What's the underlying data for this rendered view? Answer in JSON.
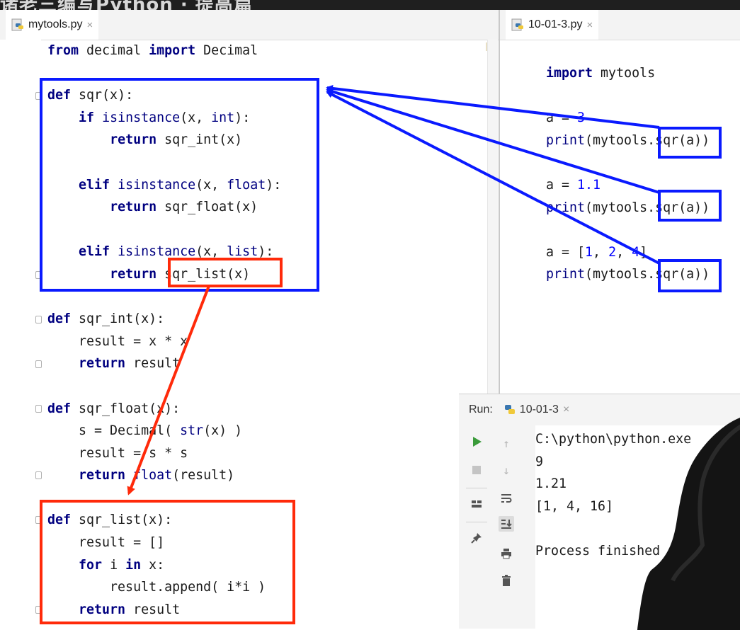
{
  "banner": {
    "text": "诸老三编写Python · 提高篇"
  },
  "editor_left": {
    "tab_label": "mytools.py",
    "lines": [
      [
        [
          "kw",
          "from"
        ],
        [
          "p",
          " decimal "
        ],
        [
          "kw",
          "import"
        ],
        [
          "p",
          " Decimal"
        ]
      ],
      [],
      [
        [
          "kw",
          "def"
        ],
        [
          "p",
          " sqr(x):"
        ]
      ],
      [
        [
          "p",
          "    "
        ],
        [
          "kw",
          "if"
        ],
        [
          "p",
          " "
        ],
        [
          "bi",
          "isinstance"
        ],
        [
          "p",
          "(x, "
        ],
        [
          "bi",
          "int"
        ],
        [
          "p",
          "):"
        ]
      ],
      [
        [
          "p",
          "        "
        ],
        [
          "kw",
          "return"
        ],
        [
          "p",
          " sqr_int(x)"
        ]
      ],
      [],
      [
        [
          "p",
          "    "
        ],
        [
          "kw",
          "elif"
        ],
        [
          "p",
          " "
        ],
        [
          "bi",
          "isinstance"
        ],
        [
          "p",
          "(x, "
        ],
        [
          "bi",
          "float"
        ],
        [
          "p",
          "):"
        ]
      ],
      [
        [
          "p",
          "        "
        ],
        [
          "kw",
          "return"
        ],
        [
          "p",
          " sqr_float(x)"
        ]
      ],
      [],
      [
        [
          "p",
          "    "
        ],
        [
          "kw",
          "elif"
        ],
        [
          "p",
          " "
        ],
        [
          "bi",
          "isinstance"
        ],
        [
          "p",
          "(x, "
        ],
        [
          "bi",
          "list"
        ],
        [
          "p",
          "):"
        ]
      ],
      [
        [
          "p",
          "        "
        ],
        [
          "kw",
          "return"
        ],
        [
          "p",
          " sqr_list(x)"
        ]
      ],
      [],
      [
        [
          "kw",
          "def"
        ],
        [
          "p",
          " sqr_int(x):"
        ]
      ],
      [
        [
          "p",
          "    result = x * x"
        ]
      ],
      [
        [
          "p",
          "    "
        ],
        [
          "kw",
          "return"
        ],
        [
          "p",
          " result"
        ]
      ],
      [],
      [
        [
          "kw",
          "def"
        ],
        [
          "p",
          " sqr_float(x):"
        ]
      ],
      [
        [
          "p",
          "    s = Decimal( "
        ],
        [
          "bi",
          "str"
        ],
        [
          "p",
          "(x) )"
        ]
      ],
      [
        [
          "p",
          "    result = s * s"
        ]
      ],
      [
        [
          "p",
          "    "
        ],
        [
          "kw",
          "return"
        ],
        [
          "p",
          " "
        ],
        [
          "bi",
          "float"
        ],
        [
          "p",
          "(result)"
        ]
      ],
      [],
      [
        [
          "kw",
          "def"
        ],
        [
          "p",
          " sqr_list(x):"
        ]
      ],
      [
        [
          "p",
          "    result = []"
        ]
      ],
      [
        [
          "p",
          "    "
        ],
        [
          "kw",
          "for"
        ],
        [
          "p",
          " i "
        ],
        [
          "kw",
          "in"
        ],
        [
          "p",
          " x:"
        ]
      ],
      [
        [
          "p",
          "        result.append( i*i )"
        ]
      ],
      [
        [
          "p",
          "    "
        ],
        [
          "kw",
          "return"
        ],
        [
          "p",
          " result"
        ]
      ]
    ]
  },
  "editor_right": {
    "tab_label": "10-01-3.py",
    "lines": [
      [
        [
          "kw",
          "import"
        ],
        [
          "p",
          " mytools"
        ]
      ],
      [],
      [
        [
          "p",
          "a = "
        ],
        [
          "num",
          "3"
        ]
      ],
      [
        [
          "bi",
          "print"
        ],
        [
          "p",
          "(mytools.sqr(a))"
        ]
      ],
      [],
      [
        [
          "p",
          "a = "
        ],
        [
          "num",
          "1.1"
        ]
      ],
      [
        [
          "bi",
          "print"
        ],
        [
          "p",
          "(mytools.sqr(a))"
        ]
      ],
      [],
      [
        [
          "p",
          "a = ["
        ],
        [
          "num",
          "1"
        ],
        [
          "p",
          ", "
        ],
        [
          "num",
          "2"
        ],
        [
          "p",
          ", "
        ],
        [
          "num",
          "4"
        ],
        [
          "p",
          "]"
        ]
      ],
      [
        [
          "bi",
          "print"
        ],
        [
          "p",
          "(mytools.sqr(a))"
        ]
      ]
    ]
  },
  "run_panel": {
    "label": "Run:",
    "config_name": "10-01-3",
    "output_lines": [
      "C:\\python\\python.exe",
      "9",
      "1.21",
      "[1, 4, 16]",
      "",
      "Process finished"
    ]
  },
  "icons": {
    "run": "run-icon",
    "stop": "stop-icon",
    "layout": "layout-icon",
    "pin": "pin-icon",
    "up": "scroll-up-icon",
    "down": "scroll-down-icon",
    "wrap": "soft-wrap-icon",
    "scroll_end": "scroll-to-end-icon",
    "print": "print-icon",
    "trash": "trash-icon"
  },
  "colors": {
    "annotation_blue": "#0a1aff",
    "annotation_red": "#ff2a0a",
    "keyword": "#000080",
    "number": "#0000ff",
    "run_green": "#3a9b3a"
  }
}
